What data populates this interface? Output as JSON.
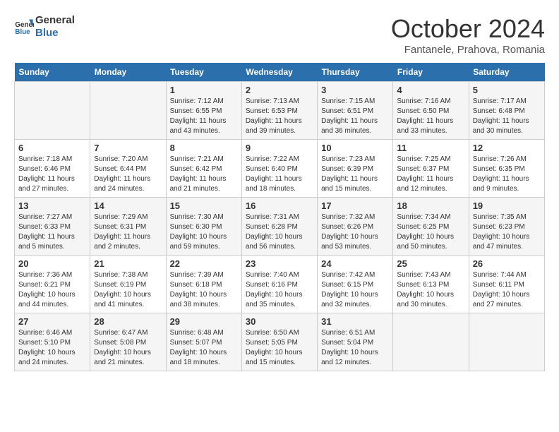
{
  "header": {
    "logo_line1": "General",
    "logo_line2": "Blue",
    "month": "October 2024",
    "location": "Fantanele, Prahova, Romania"
  },
  "weekdays": [
    "Sunday",
    "Monday",
    "Tuesday",
    "Wednesday",
    "Thursday",
    "Friday",
    "Saturday"
  ],
  "weeks": [
    [
      {
        "day": "",
        "sunrise": "",
        "sunset": "",
        "daylight": ""
      },
      {
        "day": "",
        "sunrise": "",
        "sunset": "",
        "daylight": ""
      },
      {
        "day": "1",
        "sunrise": "Sunrise: 7:12 AM",
        "sunset": "Sunset: 6:55 PM",
        "daylight": "Daylight: 11 hours and 43 minutes."
      },
      {
        "day": "2",
        "sunrise": "Sunrise: 7:13 AM",
        "sunset": "Sunset: 6:53 PM",
        "daylight": "Daylight: 11 hours and 39 minutes."
      },
      {
        "day": "3",
        "sunrise": "Sunrise: 7:15 AM",
        "sunset": "Sunset: 6:51 PM",
        "daylight": "Daylight: 11 hours and 36 minutes."
      },
      {
        "day": "4",
        "sunrise": "Sunrise: 7:16 AM",
        "sunset": "Sunset: 6:50 PM",
        "daylight": "Daylight: 11 hours and 33 minutes."
      },
      {
        "day": "5",
        "sunrise": "Sunrise: 7:17 AM",
        "sunset": "Sunset: 6:48 PM",
        "daylight": "Daylight: 11 hours and 30 minutes."
      }
    ],
    [
      {
        "day": "6",
        "sunrise": "Sunrise: 7:18 AM",
        "sunset": "Sunset: 6:46 PM",
        "daylight": "Daylight: 11 hours and 27 minutes."
      },
      {
        "day": "7",
        "sunrise": "Sunrise: 7:20 AM",
        "sunset": "Sunset: 6:44 PM",
        "daylight": "Daylight: 11 hours and 24 minutes."
      },
      {
        "day": "8",
        "sunrise": "Sunrise: 7:21 AM",
        "sunset": "Sunset: 6:42 PM",
        "daylight": "Daylight: 11 hours and 21 minutes."
      },
      {
        "day": "9",
        "sunrise": "Sunrise: 7:22 AM",
        "sunset": "Sunset: 6:40 PM",
        "daylight": "Daylight: 11 hours and 18 minutes."
      },
      {
        "day": "10",
        "sunrise": "Sunrise: 7:23 AM",
        "sunset": "Sunset: 6:39 PM",
        "daylight": "Daylight: 11 hours and 15 minutes."
      },
      {
        "day": "11",
        "sunrise": "Sunrise: 7:25 AM",
        "sunset": "Sunset: 6:37 PM",
        "daylight": "Daylight: 11 hours and 12 minutes."
      },
      {
        "day": "12",
        "sunrise": "Sunrise: 7:26 AM",
        "sunset": "Sunset: 6:35 PM",
        "daylight": "Daylight: 11 hours and 9 minutes."
      }
    ],
    [
      {
        "day": "13",
        "sunrise": "Sunrise: 7:27 AM",
        "sunset": "Sunset: 6:33 PM",
        "daylight": "Daylight: 11 hours and 5 minutes."
      },
      {
        "day": "14",
        "sunrise": "Sunrise: 7:29 AM",
        "sunset": "Sunset: 6:31 PM",
        "daylight": "Daylight: 11 hours and 2 minutes."
      },
      {
        "day": "15",
        "sunrise": "Sunrise: 7:30 AM",
        "sunset": "Sunset: 6:30 PM",
        "daylight": "Daylight: 10 hours and 59 minutes."
      },
      {
        "day": "16",
        "sunrise": "Sunrise: 7:31 AM",
        "sunset": "Sunset: 6:28 PM",
        "daylight": "Daylight: 10 hours and 56 minutes."
      },
      {
        "day": "17",
        "sunrise": "Sunrise: 7:32 AM",
        "sunset": "Sunset: 6:26 PM",
        "daylight": "Daylight: 10 hours and 53 minutes."
      },
      {
        "day": "18",
        "sunrise": "Sunrise: 7:34 AM",
        "sunset": "Sunset: 6:25 PM",
        "daylight": "Daylight: 10 hours and 50 minutes."
      },
      {
        "day": "19",
        "sunrise": "Sunrise: 7:35 AM",
        "sunset": "Sunset: 6:23 PM",
        "daylight": "Daylight: 10 hours and 47 minutes."
      }
    ],
    [
      {
        "day": "20",
        "sunrise": "Sunrise: 7:36 AM",
        "sunset": "Sunset: 6:21 PM",
        "daylight": "Daylight: 10 hours and 44 minutes."
      },
      {
        "day": "21",
        "sunrise": "Sunrise: 7:38 AM",
        "sunset": "Sunset: 6:19 PM",
        "daylight": "Daylight: 10 hours and 41 minutes."
      },
      {
        "day": "22",
        "sunrise": "Sunrise: 7:39 AM",
        "sunset": "Sunset: 6:18 PM",
        "daylight": "Daylight: 10 hours and 38 minutes."
      },
      {
        "day": "23",
        "sunrise": "Sunrise: 7:40 AM",
        "sunset": "Sunset: 6:16 PM",
        "daylight": "Daylight: 10 hours and 35 minutes."
      },
      {
        "day": "24",
        "sunrise": "Sunrise: 7:42 AM",
        "sunset": "Sunset: 6:15 PM",
        "daylight": "Daylight: 10 hours and 32 minutes."
      },
      {
        "day": "25",
        "sunrise": "Sunrise: 7:43 AM",
        "sunset": "Sunset: 6:13 PM",
        "daylight": "Daylight: 10 hours and 30 minutes."
      },
      {
        "day": "26",
        "sunrise": "Sunrise: 7:44 AM",
        "sunset": "Sunset: 6:11 PM",
        "daylight": "Daylight: 10 hours and 27 minutes."
      }
    ],
    [
      {
        "day": "27",
        "sunrise": "Sunrise: 6:46 AM",
        "sunset": "Sunset: 5:10 PM",
        "daylight": "Daylight: 10 hours and 24 minutes."
      },
      {
        "day": "28",
        "sunrise": "Sunrise: 6:47 AM",
        "sunset": "Sunset: 5:08 PM",
        "daylight": "Daylight: 10 hours and 21 minutes."
      },
      {
        "day": "29",
        "sunrise": "Sunrise: 6:48 AM",
        "sunset": "Sunset: 5:07 PM",
        "daylight": "Daylight: 10 hours and 18 minutes."
      },
      {
        "day": "30",
        "sunrise": "Sunrise: 6:50 AM",
        "sunset": "Sunset: 5:05 PM",
        "daylight": "Daylight: 10 hours and 15 minutes."
      },
      {
        "day": "31",
        "sunrise": "Sunrise: 6:51 AM",
        "sunset": "Sunset: 5:04 PM",
        "daylight": "Daylight: 10 hours and 12 minutes."
      },
      {
        "day": "",
        "sunrise": "",
        "sunset": "",
        "daylight": ""
      },
      {
        "day": "",
        "sunrise": "",
        "sunset": "",
        "daylight": ""
      }
    ]
  ]
}
